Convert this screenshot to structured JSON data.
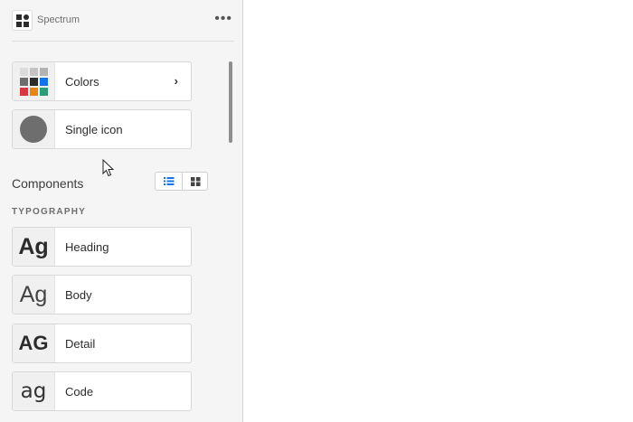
{
  "library": {
    "name": "Spectrum",
    "more_label": "•••"
  },
  "cards": [
    {
      "label": "Colors",
      "chevron": "›"
    },
    {
      "label": "Single icon"
    }
  ],
  "swatch_colors": [
    "#dcdcdc",
    "#c4c4c4",
    "#b2b2b2",
    "#6e6e6e",
    "#2c2c2c",
    "#1473e6",
    "#d7373f",
    "#e68619",
    "#2d9d78"
  ],
  "components": {
    "title": "Components",
    "view_modes": [
      "list-view-icon",
      "grid-view-icon"
    ],
    "active_view": "list",
    "group_label": "TYPOGRAPHY",
    "items": [
      {
        "glyph": "Ag",
        "label": "Heading"
      },
      {
        "glyph": "Ag",
        "label": "Body"
      },
      {
        "glyph": "AG",
        "label": "Detail"
      },
      {
        "glyph": "ag",
        "label": "Code"
      }
    ]
  },
  "accent_color": "#1473e6"
}
